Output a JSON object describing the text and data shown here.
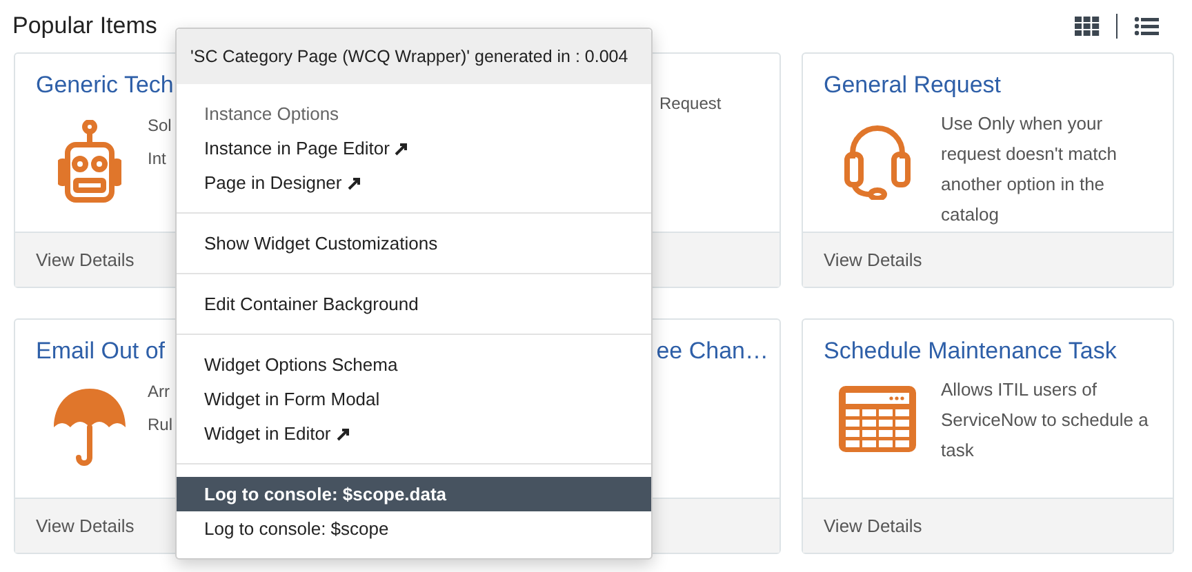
{
  "header": {
    "title": "Popular Items"
  },
  "cards": [
    {
      "kind": "clip_right",
      "title": "Generic Tech",
      "description": [
        "Sol",
        "Int"
      ],
      "footer": "View Details"
    },
    {
      "kind": "clip_left",
      "description": [
        "Request"
      ]
    },
    {
      "kind": "full",
      "title": "General Request",
      "description": [
        "Use Only when your request doesn't match another option in the catalog"
      ],
      "footer": "View Details"
    },
    {
      "kind": "clip_right",
      "title": "Email Out of",
      "description": [
        "Arr",
        "Rul"
      ],
      "footer": "View Details"
    },
    {
      "kind": "clip_left",
      "title": "ee Chan…"
    },
    {
      "kind": "full",
      "title": "Schedule Maintenance Task",
      "description": [
        "Allows ITIL users of ServiceNow to schedule a task"
      ],
      "footer": "View Details"
    }
  ],
  "menu": {
    "header": "'SC Category Page (WCQ Wrapper)' generated in : 0.004",
    "sections": [
      {
        "items": [
          {
            "label": "Instance Options",
            "kind": "heading",
            "external": false,
            "selected": false
          },
          {
            "label": "Instance in Page Editor",
            "kind": "item",
            "external": true,
            "selected": false
          },
          {
            "label": "Page in Designer",
            "kind": "item",
            "external": true,
            "selected": false
          }
        ]
      },
      {
        "items": [
          {
            "label": "Show Widget Customizations",
            "kind": "item",
            "external": false,
            "selected": false
          }
        ]
      },
      {
        "items": [
          {
            "label": "Edit Container Background",
            "kind": "item",
            "external": false,
            "selected": false
          }
        ]
      },
      {
        "items": [
          {
            "label": "Widget Options Schema",
            "kind": "item",
            "external": false,
            "selected": false
          },
          {
            "label": "Widget in Form Modal",
            "kind": "item",
            "external": false,
            "selected": false
          },
          {
            "label": "Widget in Editor",
            "kind": "item",
            "external": true,
            "selected": false
          }
        ]
      },
      {
        "items": [
          {
            "label": "Log to console: $scope.data",
            "kind": "item",
            "external": false,
            "selected": true
          },
          {
            "label": "Log to console: $scope",
            "kind": "item",
            "external": false,
            "selected": false
          }
        ]
      }
    ]
  }
}
